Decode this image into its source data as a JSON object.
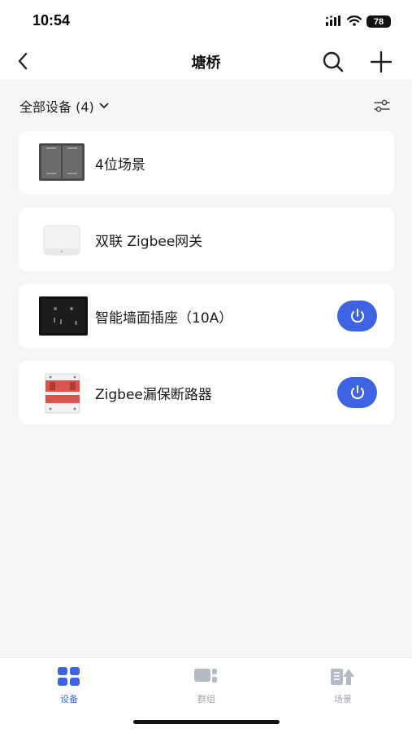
{
  "status_bar": {
    "time": "10:54",
    "battery": "78"
  },
  "header": {
    "title": "塘桥"
  },
  "filter": {
    "label": "全部设备 (4)"
  },
  "devices": [
    {
      "name": "4位场景",
      "has_power": false,
      "power_on": false
    },
    {
      "name": "双联 Zigbee网关",
      "has_power": false,
      "power_on": false
    },
    {
      "name": "智能墙面插座（10A）",
      "has_power": true,
      "power_on": true
    },
    {
      "name": "Zigbee漏保断路器",
      "has_power": true,
      "power_on": true
    }
  ],
  "tabs": [
    {
      "label": "设备",
      "icon": "devices-grid-icon",
      "active": true
    },
    {
      "label": "群组",
      "icon": "group-icon",
      "active": false
    },
    {
      "label": "场景",
      "icon": "scene-icon",
      "active": false
    }
  ],
  "colors": {
    "accent": "#3d63e0",
    "background": "#f6f6f6",
    "card": "#ffffff",
    "tab_inactive": "#a0a4ad"
  }
}
